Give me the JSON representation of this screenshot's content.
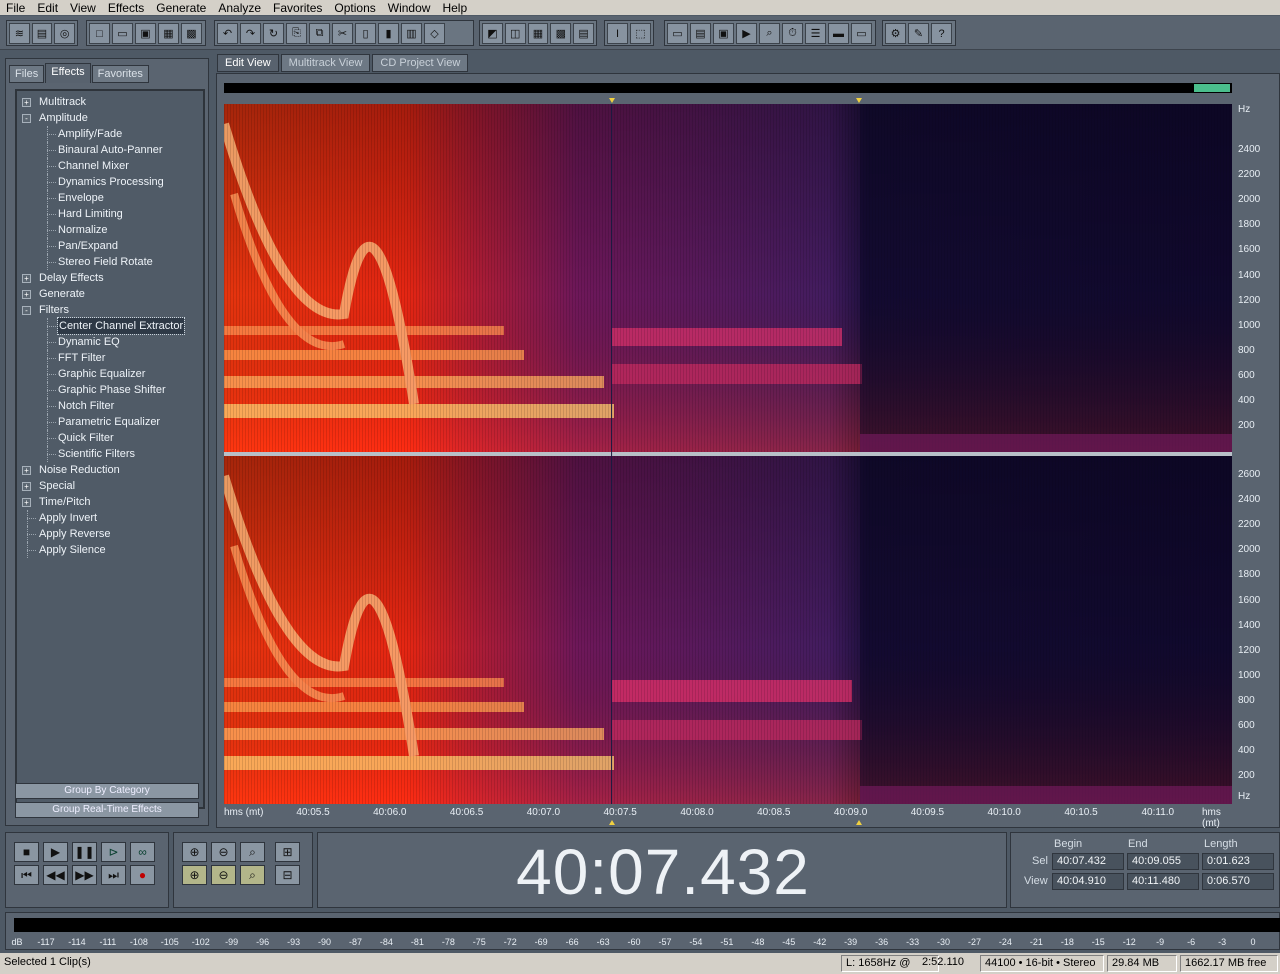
{
  "menu": [
    "File",
    "Edit",
    "View",
    "Effects",
    "Generate",
    "Analyze",
    "Favorites",
    "Options",
    "Window",
    "Help"
  ],
  "panel": {
    "tabs": [
      "Files",
      "Effects",
      "Favorites"
    ],
    "active_tab": "Effects",
    "tree": [
      {
        "label": "Multitrack",
        "kind": "group",
        "expander": "+"
      },
      {
        "label": "Amplitude",
        "kind": "group",
        "expander": "-"
      },
      {
        "label": "Amplify/Fade",
        "kind": "child"
      },
      {
        "label": "Binaural Auto-Panner",
        "kind": "child"
      },
      {
        "label": "Channel Mixer",
        "kind": "child"
      },
      {
        "label": "Dynamics Processing",
        "kind": "child"
      },
      {
        "label": "Envelope",
        "kind": "child"
      },
      {
        "label": "Hard Limiting",
        "kind": "child"
      },
      {
        "label": "Normalize",
        "kind": "child"
      },
      {
        "label": "Pan/Expand",
        "kind": "child"
      },
      {
        "label": "Stereo Field Rotate",
        "kind": "child"
      },
      {
        "label": "Delay Effects",
        "kind": "group",
        "expander": "+"
      },
      {
        "label": "Generate",
        "kind": "group",
        "expander": "+"
      },
      {
        "label": "Filters",
        "kind": "group",
        "expander": "-"
      },
      {
        "label": "Center Channel Extractor",
        "kind": "child",
        "selected": true
      },
      {
        "label": "Dynamic EQ",
        "kind": "child"
      },
      {
        "label": "FFT Filter",
        "kind": "child"
      },
      {
        "label": "Graphic Equalizer",
        "kind": "child"
      },
      {
        "label": "Graphic Phase Shifter",
        "kind": "child"
      },
      {
        "label": "Notch Filter",
        "kind": "child"
      },
      {
        "label": "Parametric Equalizer",
        "kind": "child"
      },
      {
        "label": "Quick Filter",
        "kind": "child"
      },
      {
        "label": "Scientific Filters",
        "kind": "child"
      },
      {
        "label": "Noise Reduction",
        "kind": "group",
        "expander": "+"
      },
      {
        "label": "Special",
        "kind": "group",
        "expander": "+"
      },
      {
        "label": "Time/Pitch",
        "kind": "group",
        "expander": "+"
      },
      {
        "label": "Apply Invert",
        "kind": "leaf"
      },
      {
        "label": "Apply Reverse",
        "kind": "leaf"
      },
      {
        "label": "Apply Silence",
        "kind": "leaf"
      }
    ],
    "group_by_button": "Group By Category",
    "realtime_button": "Group Real-Time Effects"
  },
  "view_tabs": [
    "Edit View",
    "Multitrack View",
    "CD Project View"
  ],
  "active_view": "Edit View",
  "spectral": {
    "hz_unit": "Hz",
    "top_channel_hz": [
      "2400",
      "2200",
      "2000",
      "1800",
      "1600",
      "1400",
      "1200",
      "1000",
      "800",
      "600",
      "400",
      "200"
    ],
    "bottom_channel_hz": [
      "2600",
      "2400",
      "2200",
      "2000",
      "1800",
      "1600",
      "1400",
      "1200",
      "1000",
      "800",
      "600",
      "400",
      "200"
    ],
    "time_format_label": "hms (mt)",
    "time_ticks": [
      "40:05.5",
      "40:06.0",
      "40:06.5",
      "40:07.0",
      "40:07.5",
      "40:08.0",
      "40:08.5",
      "40:09.0",
      "40:09.5",
      "40:10.0",
      "40:10.5",
      "40:11.0"
    ],
    "selection_start_fraction": 0.3845,
    "selection_end_fraction": 0.63
  },
  "transport_icons": [
    "stop-icon",
    "play-icon",
    "pause-icon",
    "play-to-end-icon",
    "loop-icon",
    "go-to-start-icon",
    "rewind-icon",
    "fast-forward-icon",
    "go-to-end-icon",
    "record-icon"
  ],
  "zoom_icons": [
    "zoom-in-horizontal-icon",
    "zoom-out-horizontal-icon",
    "zoom-full-icon",
    "zoom-in-vertical-icon",
    "zoom-to-left-icon",
    "zoom-to-right-icon",
    "zoom-selection-icon",
    "zoom-out-vertical-icon"
  ],
  "time_display": "40:07.432",
  "selection": {
    "headers": [
      "Begin",
      "End",
      "Length"
    ],
    "sel_label": "Sel",
    "view_label": "View",
    "sel": [
      "40:07.432",
      "40:09.055",
      "0:01.623"
    ],
    "view": [
      "40:04.910",
      "40:11.480",
      "0:06.570"
    ]
  },
  "meter": {
    "unit": "dB",
    "labels": [
      "-117",
      "-114",
      "-111",
      "-108",
      "-105",
      "-102",
      "-99",
      "-96",
      "-93",
      "-90",
      "-87",
      "-84",
      "-81",
      "-78",
      "-75",
      "-72",
      "-69",
      "-66",
      "-63",
      "-60",
      "-57",
      "-54",
      "-51",
      "-48",
      "-45",
      "-42",
      "-39",
      "-36",
      "-33",
      "-30",
      "-27",
      "-24",
      "-21",
      "-18",
      "-15",
      "-12",
      "-9",
      "-6",
      "-3",
      "0"
    ]
  },
  "status": {
    "selected": "Selected 1 Clip(s)",
    "cursor": "L: 1658Hz @",
    "cursor_time": "2:52.110",
    "format": "44100 • 16-bit • Stereo",
    "size": "29.84 MB",
    "free": "1662.17 MB free"
  },
  "colors": {
    "ui_bg": "#4e5965",
    "spectro_hot": "#ff2a10",
    "spectro_warm": "#e5205a",
    "spectro_cool": "#4a1f6a",
    "spectro_cold": "#1a0e3a",
    "overview_selection": "#4bbf8d"
  }
}
